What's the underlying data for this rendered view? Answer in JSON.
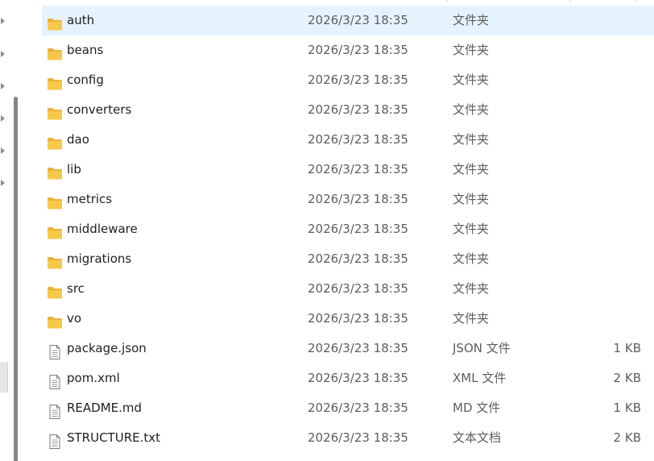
{
  "colors": {
    "folder": "#f6c94a",
    "folder_dark": "#e8b23a",
    "selection": "#e5f3ff",
    "text_primary": "#1f1f1f",
    "text_secondary": "#5d5d5d"
  },
  "files": [
    {
      "name": "auth",
      "modified": "2026/3/23 18:35",
      "type": "文件夹",
      "size": "",
      "icon": "folder-icon",
      "selected": true
    },
    {
      "name": "beans",
      "modified": "2026/3/23 18:35",
      "type": "文件夹",
      "size": "",
      "icon": "folder-icon",
      "selected": false
    },
    {
      "name": "config",
      "modified": "2026/3/23 18:35",
      "type": "文件夹",
      "size": "",
      "icon": "folder-icon",
      "selected": false
    },
    {
      "name": "converters",
      "modified": "2026/3/23 18:35",
      "type": "文件夹",
      "size": "",
      "icon": "folder-icon",
      "selected": false
    },
    {
      "name": "dao",
      "modified": "2026/3/23 18:35",
      "type": "文件夹",
      "size": "",
      "icon": "folder-icon",
      "selected": false
    },
    {
      "name": "lib",
      "modified": "2026/3/23 18:35",
      "type": "文件夹",
      "size": "",
      "icon": "folder-icon",
      "selected": false
    },
    {
      "name": "metrics",
      "modified": "2026/3/23 18:35",
      "type": "文件夹",
      "size": "",
      "icon": "folder-icon",
      "selected": false
    },
    {
      "name": "middleware",
      "modified": "2026/3/23 18:35",
      "type": "文件夹",
      "size": "",
      "icon": "folder-icon",
      "selected": false
    },
    {
      "name": "migrations",
      "modified": "2026/3/23 18:35",
      "type": "文件夹",
      "size": "",
      "icon": "folder-icon",
      "selected": false
    },
    {
      "name": "src",
      "modified": "2026/3/23 18:35",
      "type": "文件夹",
      "size": "",
      "icon": "folder-icon",
      "selected": false
    },
    {
      "name": "vo",
      "modified": "2026/3/23 18:35",
      "type": "文件夹",
      "size": "",
      "icon": "folder-icon",
      "selected": false
    },
    {
      "name": "package.json",
      "modified": "2026/3/23 18:35",
      "type": "JSON 文件",
      "size": "1 KB",
      "icon": "file-icon",
      "selected": false
    },
    {
      "name": "pom.xml",
      "modified": "2026/3/23 18:35",
      "type": "XML 文件",
      "size": "2 KB",
      "icon": "file-icon",
      "selected": false
    },
    {
      "name": "README.md",
      "modified": "2026/3/23 18:35",
      "type": "MD 文件",
      "size": "1 KB",
      "icon": "file-icon",
      "selected": false
    },
    {
      "name": "STRUCTURE.txt",
      "modified": "2026/3/23 18:35",
      "type": "文本文档",
      "size": "2 KB",
      "icon": "file-icon",
      "selected": false
    }
  ]
}
